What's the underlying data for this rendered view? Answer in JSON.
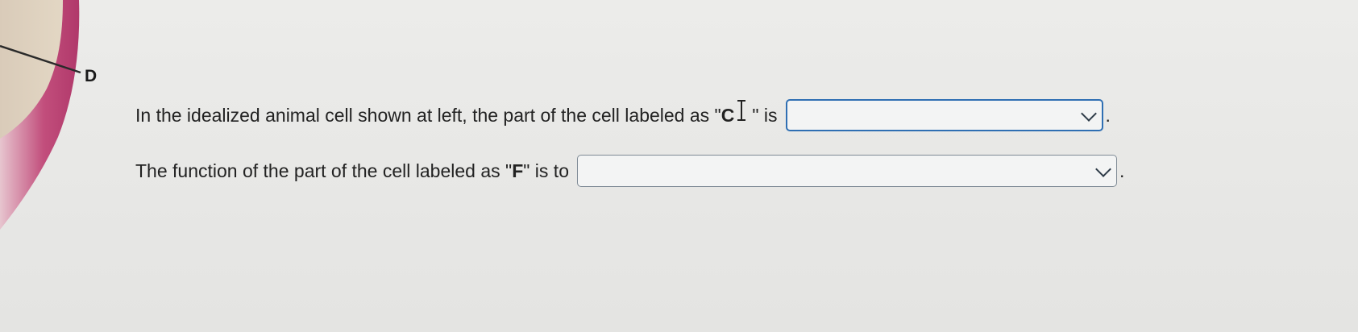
{
  "figure": {
    "label_d": "D"
  },
  "question": {
    "line1_text_before": "In the idealized animal cell shown at left, the part of the cell labeled as \"",
    "line1_label": "C",
    "line1_text_after": "\" is",
    "line1_dropdown_value": "",
    "line2_text_before": "The function of the part of the cell labeled as \"",
    "line2_label": "F",
    "line2_text_after": "\" is to",
    "line2_dropdown_value": "",
    "period": "."
  },
  "colors": {
    "cell_membrane": "#b8416f",
    "focus_border": "#2f6fb3",
    "dropdown_border": "#7e8a95"
  },
  "icons": {
    "dropdown": "chevron-down-icon",
    "cursor": "text-cursor-icon"
  }
}
